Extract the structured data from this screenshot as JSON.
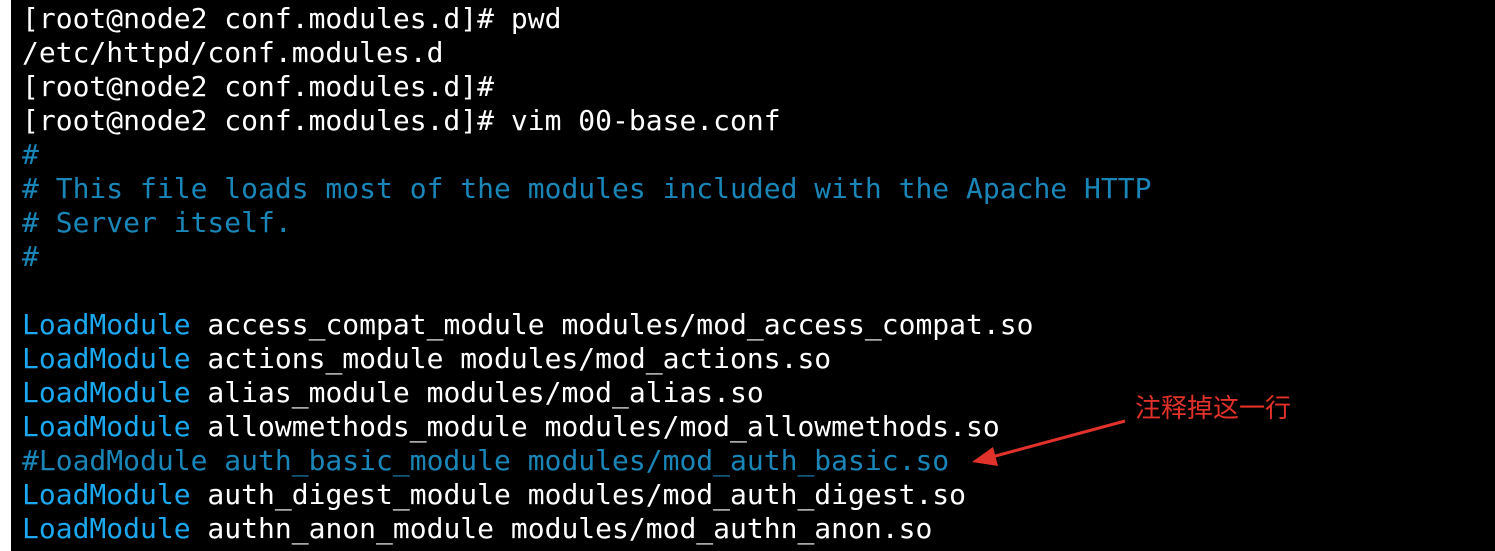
{
  "terminal": {
    "colors": {
      "background": "#000000",
      "text": "#ffffff",
      "keyword": "#1ba8ef",
      "comment": "#1a86b8",
      "annotation": "#e0312a"
    },
    "lines": [
      {
        "segments": [
          {
            "text": "[root@node2 conf.modules.d]# pwd",
            "style": "plain"
          }
        ]
      },
      {
        "segments": [
          {
            "text": "/etc/httpd/conf.modules.d",
            "style": "plain"
          }
        ]
      },
      {
        "segments": [
          {
            "text": "[root@node2 conf.modules.d]#",
            "style": "plain"
          }
        ]
      },
      {
        "segments": [
          {
            "text": "[root@node2 conf.modules.d]# vim 00-base.conf",
            "style": "plain"
          }
        ]
      },
      {
        "segments": [
          {
            "text": "#",
            "style": "comment"
          }
        ]
      },
      {
        "segments": [
          {
            "text": "# This file loads most of the modules included with the Apache HTTP",
            "style": "comment"
          }
        ]
      },
      {
        "segments": [
          {
            "text": "# Server itself.",
            "style": "comment"
          }
        ]
      },
      {
        "segments": [
          {
            "text": "#",
            "style": "comment"
          }
        ]
      },
      {
        "segments": [
          {
            "text": "",
            "style": "plain"
          }
        ]
      },
      {
        "segments": [
          {
            "text": "LoadModule",
            "style": "keyword"
          },
          {
            "text": " access_compat_module modules/mod_access_compat.so",
            "style": "plain"
          }
        ]
      },
      {
        "segments": [
          {
            "text": "LoadModule",
            "style": "keyword"
          },
          {
            "text": " actions_module modules/mod_actions.so",
            "style": "plain"
          }
        ]
      },
      {
        "segments": [
          {
            "text": "LoadModule",
            "style": "keyword"
          },
          {
            "text": " alias_module modules/mod_alias.so",
            "style": "plain"
          }
        ]
      },
      {
        "segments": [
          {
            "text": "LoadModule",
            "style": "keyword"
          },
          {
            "text": " allowmethods_module modules/mod_allowmethods.so",
            "style": "plain"
          }
        ]
      },
      {
        "segments": [
          {
            "text": "#LoadModule auth_basic_module modules/mod_auth_basic.so",
            "style": "comment"
          }
        ]
      },
      {
        "segments": [
          {
            "text": "LoadModule",
            "style": "keyword"
          },
          {
            "text": " auth_digest_module modules/mod_auth_digest.so",
            "style": "plain"
          }
        ]
      },
      {
        "segments": [
          {
            "text": "LoadModule",
            "style": "keyword"
          },
          {
            "text": " authn_anon_module modules/mod_authn_anon.so",
            "style": "plain"
          }
        ]
      }
    ]
  },
  "annotation": {
    "text": "注释掉这一行",
    "arrow_icon": "red-arrow-icon"
  }
}
